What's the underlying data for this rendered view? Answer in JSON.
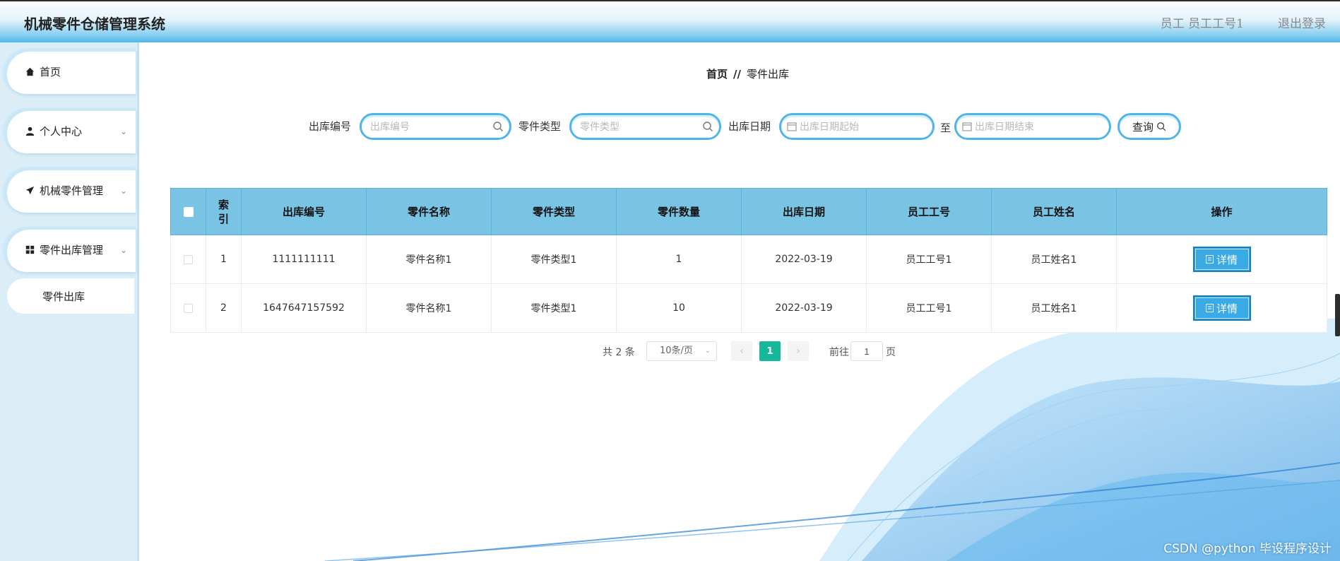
{
  "header": {
    "app_title": "机械零件仓储管理系统",
    "user_info": "员工  员工工号1",
    "logout_label": "退出登录"
  },
  "sidebar": {
    "items": [
      {
        "label": "首页",
        "icon": "home-icon"
      },
      {
        "label": "个人中心",
        "icon": "user-icon"
      },
      {
        "label": "机械零件管理",
        "icon": "send-icon"
      },
      {
        "label": "零件出库管理",
        "icon": "grid-icon"
      }
    ],
    "subitem_label": "零件出库"
  },
  "breadcrumb": {
    "home": "首页",
    "separator": "//",
    "current": "零件出库"
  },
  "search": {
    "outbound_no_label": "出库编号",
    "outbound_no_placeholder": "出库编号",
    "part_type_label": "零件类型",
    "part_type_placeholder": "零件类型",
    "date_label": "出库日期",
    "date_start_placeholder": "出库日期起始",
    "date_to": "至",
    "date_end_placeholder": "出库日期结束",
    "query_label": "查询"
  },
  "table": {
    "columns": [
      "索\n引",
      "出库编号",
      "零件名称",
      "零件类型",
      "零件数量",
      "出库日期",
      "员工工号",
      "员工姓名",
      "操作"
    ],
    "rows": [
      {
        "index": "1",
        "outbound_no": "1111111111",
        "part_name": "零件名称1",
        "part_type": "零件类型1",
        "quantity": "1",
        "date": "2022-03-19",
        "emp_no": "员工工号1",
        "emp_name": "员工姓名1",
        "action": "详情"
      },
      {
        "index": "2",
        "outbound_no": "1647647157592",
        "part_name": "零件名称1",
        "part_type": "零件类型1",
        "quantity": "10",
        "date": "2022-03-19",
        "emp_no": "员工工号1",
        "emp_name": "员工姓名1",
        "action": "详情"
      }
    ]
  },
  "pagination": {
    "total": "共 2 条",
    "page_size": "10条/页",
    "current_page": "1",
    "goto_label": "前往",
    "goto_value": "1",
    "page_suffix": "页"
  },
  "watermark": "CSDN @python 毕设程序设计",
  "colors": {
    "accent": "#4fb5e8",
    "table_header": "#79c4e5",
    "pager_active": "#15b99a",
    "detail_button": "#3aaae4"
  }
}
